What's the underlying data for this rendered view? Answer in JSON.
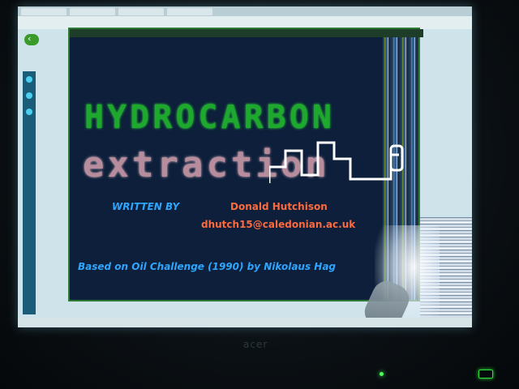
{
  "game": {
    "title_line1": "HYDROCARBON",
    "title_line2": "extraction",
    "credit_label": "WRITTEN BY",
    "credit_name": "Donald Hutchison",
    "credit_email": "dhutch15@caledonian.ac.uk",
    "based_on": "Based on Oil Challenge (1990) by Nikolaus Hag"
  },
  "monitor": {
    "brand": "acer"
  },
  "colors": {
    "title_green": "#1fa82e",
    "title_pink": "#b78d9e",
    "credit_blue": "#2ea6ff",
    "credit_orange": "#ff6a3d",
    "game_bg": "#0d1f3a"
  }
}
